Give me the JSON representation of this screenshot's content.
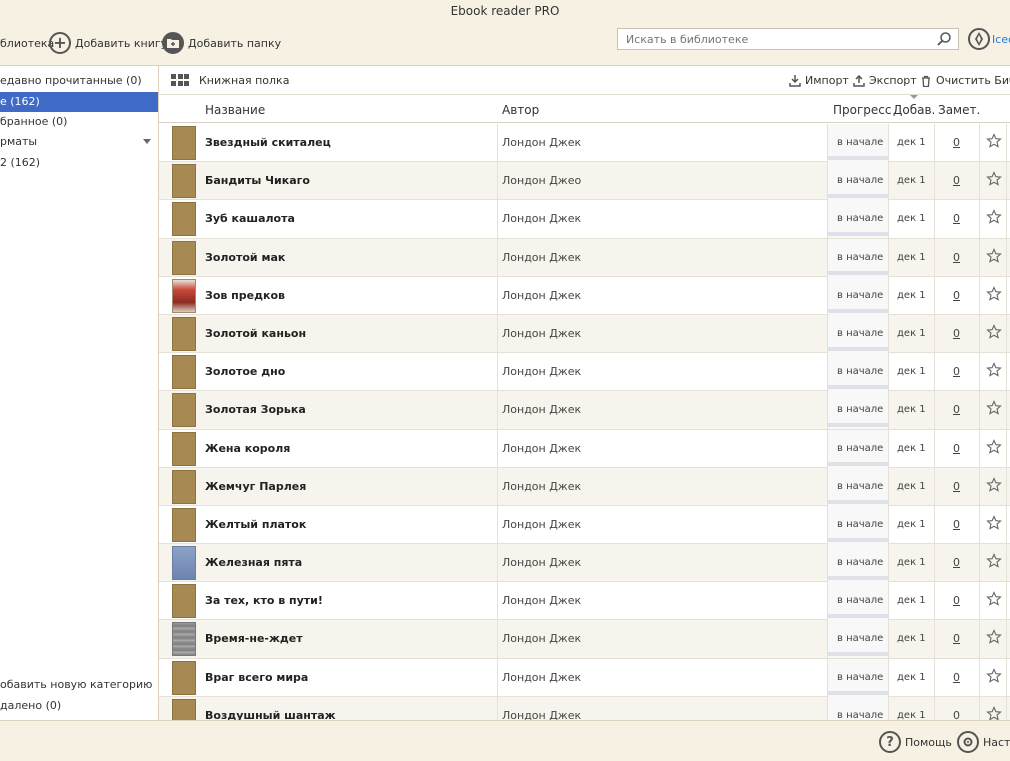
{
  "window": {
    "title": "Ebook reader PRO"
  },
  "toolbar": {
    "library_label": "блиотека",
    "add_book_label": "Добавить книгу",
    "add_folder_label": "Добавить папку",
    "search_placeholder": "Искать в библиотеке",
    "user_label": "Icec"
  },
  "sidebar": {
    "items": [
      {
        "label": "едавно прочитанные (0)"
      },
      {
        "label": "е (162)"
      },
      {
        "label": "бранное (0)"
      },
      {
        "label": "рматы"
      },
      {
        "label": "2 (162)"
      }
    ],
    "add_category": "обавить новую категорию",
    "deleted": "далено (0)"
  },
  "subbar": {
    "shelf_label": "Книжная полка",
    "import_label": "Импорт",
    "export_label": "Экспорт",
    "clear_label": "Очистить Библ"
  },
  "columns": {
    "title": "Название",
    "author": "Автор",
    "progress": "Прогресс",
    "added": "Добав.",
    "notes": "Замет."
  },
  "books": [
    {
      "title": "Звездный скиталец",
      "author": "Лондон Джек",
      "progress": "в начале",
      "added": "дек 1",
      "notes": "0",
      "cover": "plain"
    },
    {
      "title": "Бандиты Чикаго",
      "author": "Лондон Джео",
      "progress": "в начале",
      "added": "дек 1",
      "notes": "0",
      "cover": "plain"
    },
    {
      "title": "Зуб кашалота",
      "author": "Лондон Джек",
      "progress": "в начале",
      "added": "дек 1",
      "notes": "0",
      "cover": "plain"
    },
    {
      "title": "Золотой мак",
      "author": "Лондон Джек",
      "progress": "в начале",
      "added": "дек 1",
      "notes": "0",
      "cover": "plain"
    },
    {
      "title": "Зов предков",
      "author": "Лондон Джек",
      "progress": "в начале",
      "added": "дек 1",
      "notes": "0",
      "cover": "red"
    },
    {
      "title": "Золотой каньон",
      "author": "Лондон Джек",
      "progress": "в начале",
      "added": "дек 1",
      "notes": "0",
      "cover": "plain"
    },
    {
      "title": "Золотое дно",
      "author": "Лондон Джек",
      "progress": "в начале",
      "added": "дек 1",
      "notes": "0",
      "cover": "plain"
    },
    {
      "title": "Золотая Зорька",
      "author": "Лондон Джек",
      "progress": "в начале",
      "added": "дек 1",
      "notes": "0",
      "cover": "plain"
    },
    {
      "title": "Жена короля",
      "author": "Лондон Джек",
      "progress": "в начале",
      "added": "дек 1",
      "notes": "0",
      "cover": "plain"
    },
    {
      "title": "Жемчуг Парлея",
      "author": "Лондон Джек",
      "progress": "в начале",
      "added": "дек 1",
      "notes": "0",
      "cover": "plain"
    },
    {
      "title": "Желтый платок",
      "author": "Лондон Джек",
      "progress": "в начале",
      "added": "дек 1",
      "notes": "0",
      "cover": "plain"
    },
    {
      "title": "Железная пята",
      "author": "Лондон Джек",
      "progress": "в начале",
      "added": "дек 1",
      "notes": "0",
      "cover": "blue"
    },
    {
      "title": "За тех, кто в пути!",
      "author": "Лондон Джек",
      "progress": "в начале",
      "added": "дек 1",
      "notes": "0",
      "cover": "plain"
    },
    {
      "title": "Время-не-ждет",
      "author": "Лондон Джек",
      "progress": "в начале",
      "added": "дек 1",
      "notes": "0",
      "cover": "gray"
    },
    {
      "title": "Враг всего мира",
      "author": "Лондон Джек",
      "progress": "в начале",
      "added": "дек 1",
      "notes": "0",
      "cover": "plain"
    },
    {
      "title": "Воздушный шантаж",
      "author": "Лондон Джек",
      "progress": "в начале",
      "added": "дек 1",
      "notes": "0",
      "cover": "plain"
    }
  ],
  "statusbar": {
    "help_label": "Помощь",
    "settings_label": "Настр"
  },
  "colors": {
    "chrome_bg": "#f6f1e3",
    "selection": "#3f6bc6",
    "link": "#2a7ad5",
    "cover_default": "#a78a53"
  }
}
